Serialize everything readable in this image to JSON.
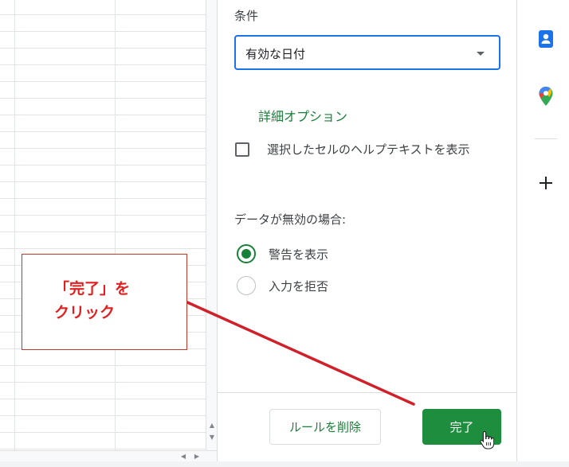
{
  "panel": {
    "condition_label": "条件",
    "condition_value": "有効な日付",
    "advanced_options": "詳細オプション",
    "help_text_checkbox": "選択したセルのヘルプテキストを表示",
    "help_text_checked": false,
    "invalid_data_label": "データが無効の場合:",
    "radio_options": [
      {
        "label": "警告を表示",
        "selected": true
      },
      {
        "label": "入力を拒否",
        "selected": false
      }
    ],
    "delete_rule_button": "ルールを削除",
    "done_button": "完了"
  },
  "sidebar": {
    "icons": [
      "contacts-icon",
      "maps-icon",
      "add-icon"
    ]
  },
  "annotation": {
    "text": "「完了」を\nクリック"
  },
  "colors": {
    "accent_green": "#188038",
    "done_button": "#1e8e3e",
    "focus_blue": "#1a73e8",
    "annotation_red": "#e02020"
  }
}
